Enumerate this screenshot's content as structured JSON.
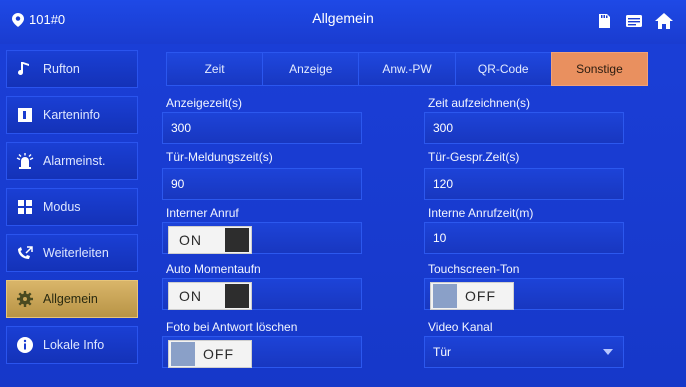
{
  "header": {
    "room": "101#0",
    "title": "Allgemein"
  },
  "sidebar": {
    "items": [
      {
        "label": "Rufton",
        "icon": "music-note-icon"
      },
      {
        "label": "Karteninfo",
        "icon": "card-icon"
      },
      {
        "label": "Alarmeinst.",
        "icon": "alarm-icon"
      },
      {
        "label": "Modus",
        "icon": "grid-icon"
      },
      {
        "label": "Weiterleiten",
        "icon": "forward-call-icon"
      },
      {
        "label": "Allgemein",
        "icon": "gear-icon",
        "active": true
      },
      {
        "label": "Lokale Info",
        "icon": "info-icon"
      }
    ]
  },
  "tabs": [
    {
      "label": "Zeit"
    },
    {
      "label": "Anzeige"
    },
    {
      "label": "Anw.-PW"
    },
    {
      "label": "QR-Code"
    },
    {
      "label": "Sonstige",
      "active": true
    }
  ],
  "form": {
    "left": {
      "anzeigezeit": {
        "label": "Anzeigezeit(s)",
        "value": "300"
      },
      "tuer_meldungszeit": {
        "label": "Tür-Meldungszeit(s)",
        "value": "90"
      },
      "interner_anruf": {
        "label": "Interner Anruf",
        "state": "ON"
      },
      "auto_momentaufn": {
        "label": "Auto Momentaufn",
        "state": "ON"
      },
      "foto_loeschen": {
        "label": "Foto bei Antwort löschen",
        "state": "OFF"
      }
    },
    "right": {
      "zeit_aufzeichnen": {
        "label": "Zeit aufzeichnen(s)",
        "value": "300"
      },
      "tuer_gespr_zeit": {
        "label": "Tür-Gespr.Zeit(s)",
        "value": "120"
      },
      "interne_anrufzeit": {
        "label": "Interne Anrufzeit(m)",
        "value": "10"
      },
      "touchscreen_ton": {
        "label": "Touchscreen-Ton",
        "state": "OFF"
      },
      "video_kanal": {
        "label": "Video Kanal",
        "value": "Tür"
      }
    }
  },
  "colors": {
    "background": "#1a3cd0",
    "active_sidebar": "#c9a558",
    "active_tab": "#e9905f"
  }
}
